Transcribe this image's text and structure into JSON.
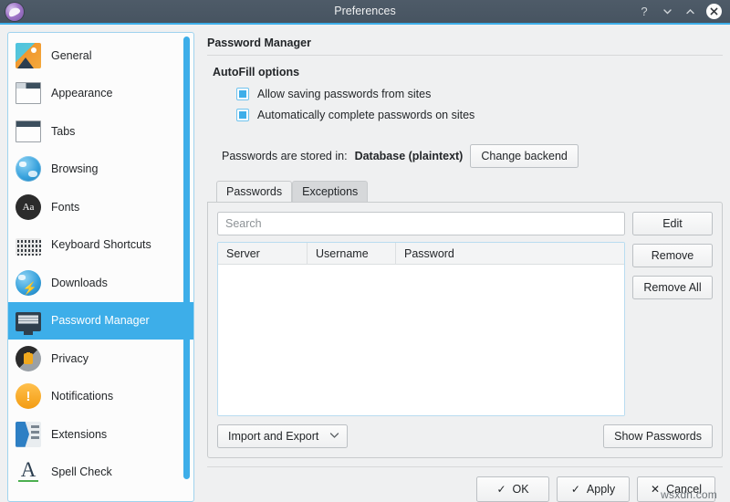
{
  "window": {
    "title": "Preferences",
    "app_icon": "falkon-logo-icon",
    "controls": [
      {
        "name": "help-button",
        "glyph": "?"
      },
      {
        "name": "minimize-button",
        "glyph": "chevron-down"
      },
      {
        "name": "maximize-button",
        "glyph": "chevron-up"
      },
      {
        "name": "close-button",
        "glyph": "x"
      }
    ],
    "titlebar_bg": "#4b5865",
    "accent": "#3daee9"
  },
  "sidebar": {
    "selected_index": 7,
    "scrollbar_color": "#3daee9",
    "items": [
      {
        "label": "General",
        "icon": "general-icon"
      },
      {
        "label": "Appearance",
        "icon": "appearance-window-icon"
      },
      {
        "label": "Tabs",
        "icon": "tabs-window-icon"
      },
      {
        "label": "Browsing",
        "icon": "globe-icon"
      },
      {
        "label": "Fonts",
        "icon": "fonts-aa-icon"
      },
      {
        "label": "Keyboard Shortcuts",
        "icon": "keyboard-icon"
      },
      {
        "label": "Downloads",
        "icon": "downloads-icon"
      },
      {
        "label": "Password Manager",
        "icon": "password-manager-icon"
      },
      {
        "label": "Privacy",
        "icon": "privacy-lock-icon"
      },
      {
        "label": "Notifications",
        "icon": "notifications-bell-icon"
      },
      {
        "label": "Extensions",
        "icon": "extensions-icon"
      },
      {
        "label": "Spell Check",
        "icon": "spell-check-icon"
      }
    ]
  },
  "main": {
    "page_title": "Password Manager",
    "autofill": {
      "group_title": "AutoFill options",
      "options": [
        {
          "label": "Allow saving passwords from sites",
          "checked": true
        },
        {
          "label": "Automatically complete passwords on sites",
          "checked": true
        }
      ]
    },
    "backend": {
      "label": "Passwords are stored in:",
      "value": "Database (plaintext)",
      "change_button": "Change backend"
    },
    "tabs": [
      {
        "label": "Passwords",
        "active": true
      },
      {
        "label": "Exceptions",
        "active": false
      }
    ],
    "search": {
      "value": "",
      "placeholder": "Search"
    },
    "table": {
      "columns": [
        "Server",
        "Username",
        "Password"
      ],
      "rows": []
    },
    "side_buttons": [
      {
        "label": "Edit"
      },
      {
        "label": "Remove"
      },
      {
        "label": "Remove All"
      }
    ],
    "footer": {
      "import_export": "Import and Export",
      "import_export_chevron": "chevron-down",
      "show_passwords": "Show Passwords"
    }
  },
  "bottom_bar": {
    "buttons": [
      {
        "label": "OK",
        "glyph": "✓",
        "name": "ok-button"
      },
      {
        "label": "Apply",
        "glyph": "✓",
        "name": "apply-button"
      },
      {
        "label": "Cancel",
        "glyph": "✕",
        "name": "cancel-button"
      }
    ]
  },
  "watermark": "wsxdn.com"
}
